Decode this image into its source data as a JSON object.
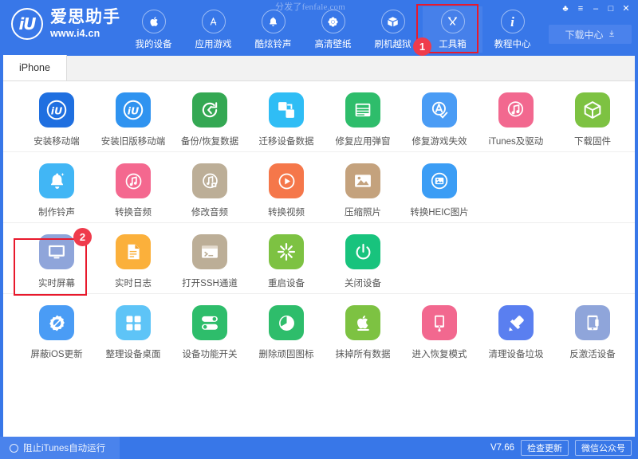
{
  "window": {
    "watermark": "分发了fenfale.com",
    "controls": [
      {
        "name": "skin-icon",
        "glyph": "♣"
      },
      {
        "name": "menu-icon",
        "glyph": "≡"
      },
      {
        "name": "minimize-icon",
        "glyph": "–"
      },
      {
        "name": "maximize-icon",
        "glyph": "□"
      },
      {
        "name": "close-icon",
        "glyph": "✕"
      }
    ]
  },
  "brand": {
    "logo_text": "iU",
    "name_cn": "爱思助手",
    "url": "www.i4.cn"
  },
  "nav": {
    "items": [
      {
        "label": "我的设备",
        "icon": "apple-icon",
        "active": false
      },
      {
        "label": "应用游戏",
        "icon": "appstore-icon",
        "active": false
      },
      {
        "label": "酷炫铃声",
        "icon": "bell-icon",
        "active": false
      },
      {
        "label": "高清壁纸",
        "icon": "flower-icon",
        "active": false
      },
      {
        "label": "刷机越狱",
        "icon": "box-open-icon",
        "active": false
      },
      {
        "label": "工具箱",
        "icon": "wrench-icon",
        "active": true
      },
      {
        "label": "教程中心",
        "icon": "info-icon",
        "active": false
      }
    ],
    "download_label": "下载中心",
    "download_icon": "download-arrow-icon"
  },
  "tabs": [
    {
      "label": "iPhone",
      "active": true
    }
  ],
  "tools": {
    "rows": [
      [
        {
          "label": "安装移动端",
          "icon": "i4-app-icon",
          "color": "#1f6fe0"
        },
        {
          "label": "安装旧版移动端",
          "icon": "i4-app-old-icon",
          "color": "#2f93f0"
        },
        {
          "label": "备份/恢复数据",
          "icon": "backup-restore-icon",
          "color": "#34a853"
        },
        {
          "label": "迁移设备数据",
          "icon": "migrate-data-icon",
          "color": "#2fbdf5"
        },
        {
          "label": "修复应用弹窗",
          "icon": "appleid-card-icon",
          "color": "#2ebd6b"
        },
        {
          "label": "修复游戏失效",
          "icon": "appstore-check-icon",
          "color": "#4a9cf5"
        },
        {
          "label": "iTunes及驱动",
          "icon": "itunes-driver-icon",
          "color": "#f2688f"
        },
        {
          "label": "下载固件",
          "icon": "firmware-box-icon",
          "color": "#7dc242"
        }
      ],
      [
        {
          "label": "制作铃声",
          "icon": "ringtone-bell-icon",
          "color": "#41b6f5"
        },
        {
          "label": "转换音频",
          "icon": "convert-audio-icon",
          "color": "#f4688f"
        },
        {
          "label": "修改音频",
          "icon": "edit-audio-icon",
          "color": "#bcae97"
        },
        {
          "label": "转换视频",
          "icon": "convert-video-icon",
          "color": "#f5774a"
        },
        {
          "label": "压缩照片",
          "icon": "compress-photo-icon",
          "color": "#c4a27d"
        },
        {
          "label": "转换HEIC图片",
          "icon": "heic-convert-icon",
          "color": "#3b9df5"
        }
      ],
      [
        {
          "label": "实时屏幕",
          "icon": "live-screen-icon",
          "color": "#8fa5da"
        },
        {
          "label": "实时日志",
          "icon": "live-log-icon",
          "color": "#fbb03b"
        },
        {
          "label": "打开SSH通道",
          "icon": "ssh-terminal-icon",
          "color": "#bcae97"
        },
        {
          "label": "重启设备",
          "icon": "restart-device-icon",
          "color": "#7dc242"
        },
        {
          "label": "关闭设备",
          "icon": "power-off-icon",
          "color": "#18c37d"
        }
      ],
      [
        {
          "label": "屏蔽iOS更新",
          "icon": "block-ios-update-icon",
          "color": "#4a9cf5"
        },
        {
          "label": "整理设备桌面",
          "icon": "organize-desktop-icon",
          "color": "#5ec4f7"
        },
        {
          "label": "设备功能开关",
          "icon": "feature-toggle-icon",
          "color": "#2ebd6b"
        },
        {
          "label": "删除顽固图标",
          "icon": "delete-icon-icon",
          "color": "#2ebd6b"
        },
        {
          "label": "抹掉所有数据",
          "icon": "erase-all-data-icon",
          "color": "#7dc242"
        },
        {
          "label": "进入恢复模式",
          "icon": "recovery-mode-icon",
          "color": "#f2688f"
        },
        {
          "label": "清理设备垃圾",
          "icon": "clean-junk-icon",
          "color": "#5a7ff0"
        },
        {
          "label": "反激活设备",
          "icon": "deactivate-device-icon",
          "color": "#8fa5da"
        }
      ]
    ]
  },
  "annotations": [
    {
      "number": "1",
      "target": "工具箱"
    },
    {
      "number": "2",
      "target": "实时屏幕"
    }
  ],
  "status": {
    "block_itunes_label": "阻止iTunes自动运行",
    "version": "V7.66",
    "check_update_label": "检查更新",
    "wechat_label": "微信公众号"
  },
  "colors": {
    "header_blue": "#3877e8",
    "accent_red": "#e8192c",
    "badge_red": "#ef3b4c"
  }
}
